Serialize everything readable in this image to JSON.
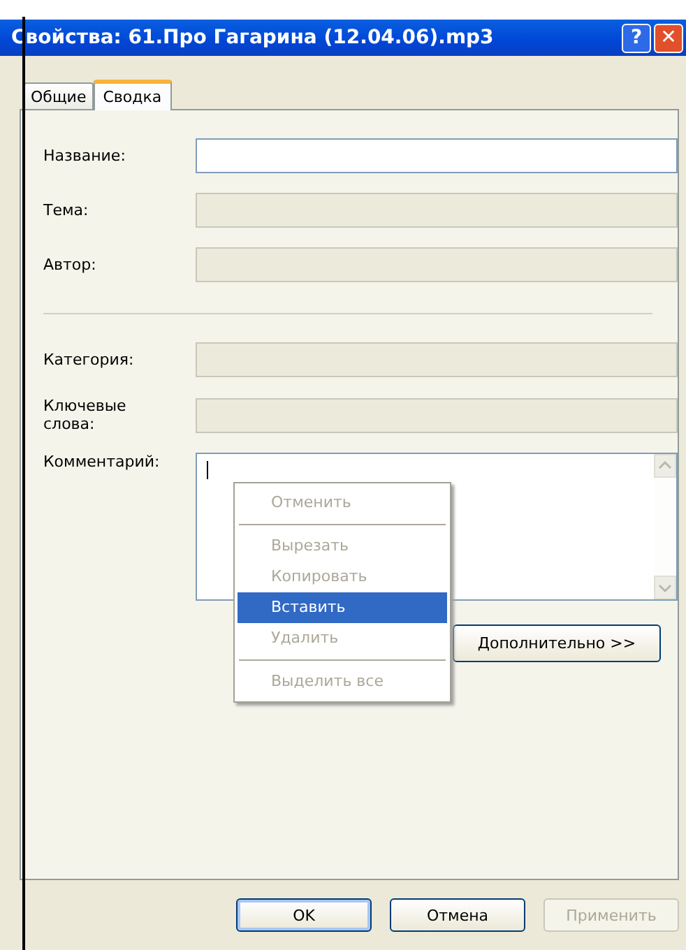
{
  "window": {
    "title": "Свойства: 61.Про Гагарина (12.04.06).mp3",
    "help": "?",
    "close": "✕"
  },
  "tabs": [
    {
      "label": "Общие",
      "selected": false
    },
    {
      "label": "Сводка",
      "selected": true
    }
  ],
  "fields_top": [
    {
      "label": "Название:",
      "disabled": false
    },
    {
      "label": "Тема:",
      "disabled": true
    },
    {
      "label": "Автор:",
      "disabled": true
    }
  ],
  "fields_bottom": [
    {
      "label": "Категория:",
      "disabled": true
    },
    {
      "label": "Ключевые слова:",
      "disabled": true
    }
  ],
  "comment": {
    "label": "Комментарий:"
  },
  "advanced_button": "Дополнительно >>",
  "context_menu": [
    {
      "kind": "item",
      "label": "Отменить",
      "disabled": true,
      "selected": false
    },
    {
      "kind": "separator"
    },
    {
      "kind": "item",
      "label": "Вырезать",
      "disabled": true,
      "selected": false
    },
    {
      "kind": "item",
      "label": "Копировать",
      "disabled": true,
      "selected": false
    },
    {
      "kind": "item",
      "label": "Вставить",
      "disabled": false,
      "selected": true
    },
    {
      "kind": "item",
      "label": "Удалить",
      "disabled": true,
      "selected": false
    },
    {
      "kind": "separator"
    },
    {
      "kind": "item",
      "label": "Выделить все",
      "disabled": true,
      "selected": false
    }
  ],
  "buttons": [
    {
      "label": "OK",
      "disabled": false,
      "default": true
    },
    {
      "label": "Отмена",
      "disabled": false,
      "default": false
    },
    {
      "label": "Применить",
      "disabled": true,
      "default": false
    }
  ]
}
